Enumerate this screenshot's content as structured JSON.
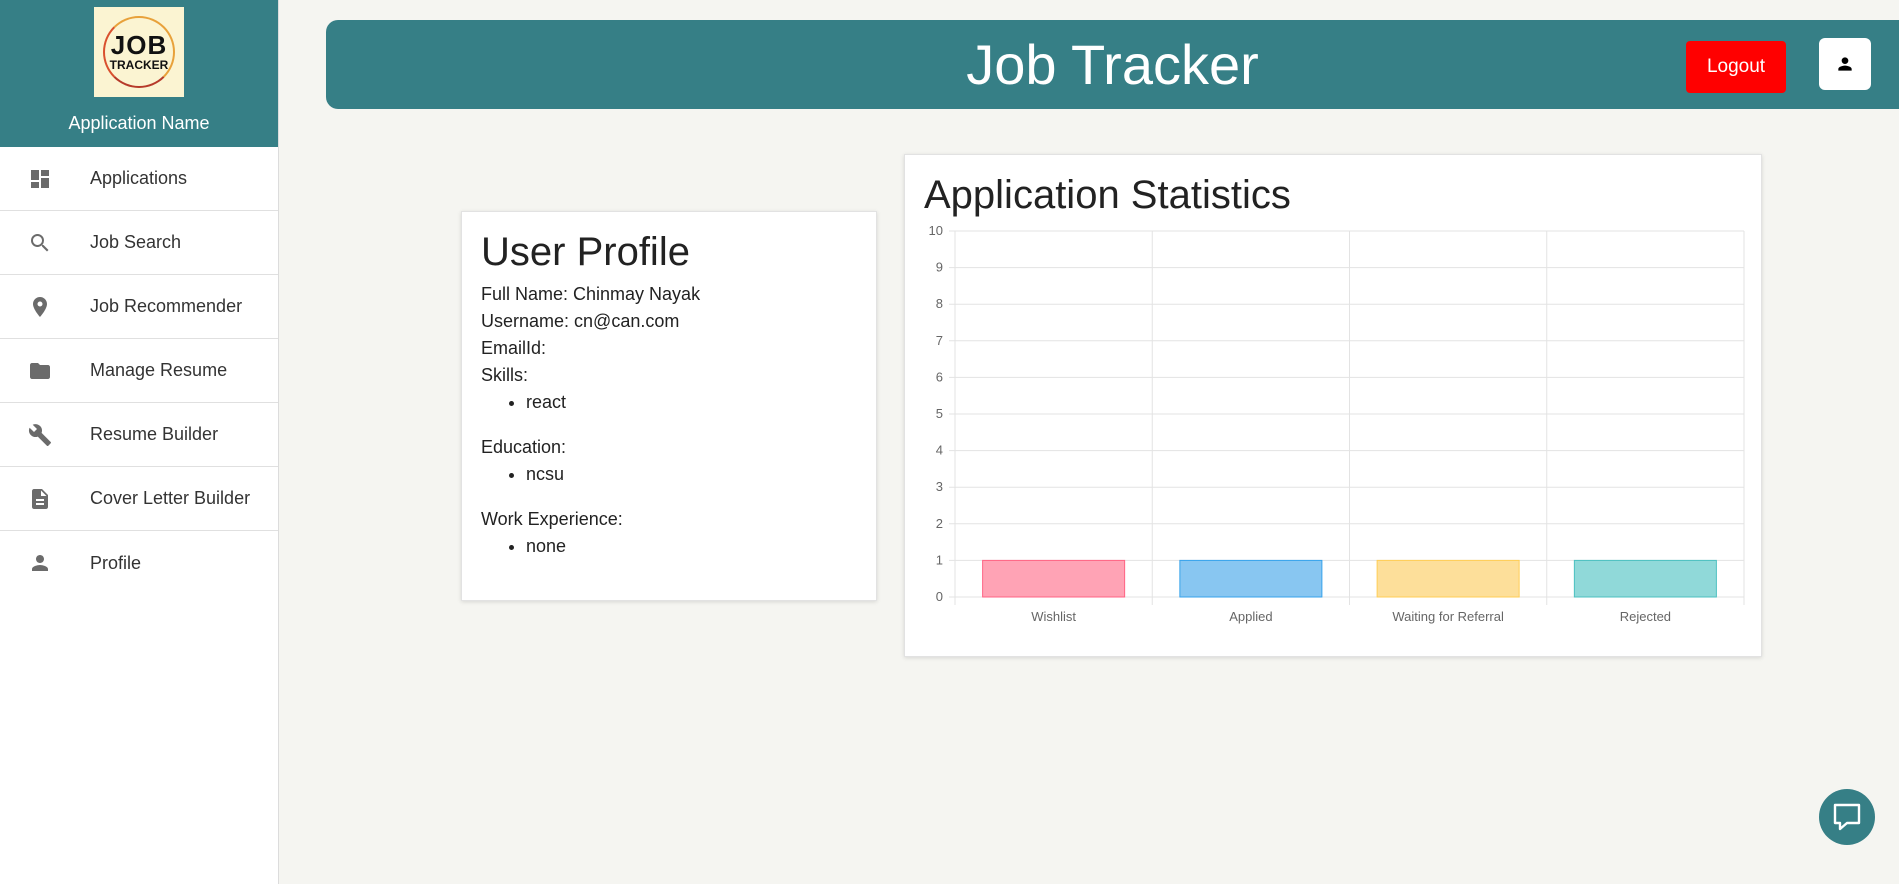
{
  "sidebar": {
    "logo": {
      "line1": "JOB",
      "line2": "TRACKER"
    },
    "app_name": "Application Name",
    "items": [
      {
        "label": "Applications",
        "icon": "dashboard-icon"
      },
      {
        "label": "Job Search",
        "icon": "search-icon"
      },
      {
        "label": "Job Recommender",
        "icon": "location-pin-icon"
      },
      {
        "label": "Manage Resume",
        "icon": "folder-icon"
      },
      {
        "label": "Resume Builder",
        "icon": "wrench-icon"
      },
      {
        "label": "Cover Letter Builder",
        "icon": "document-icon"
      },
      {
        "label": "Profile",
        "icon": "person-icon"
      }
    ]
  },
  "header": {
    "title": "Job Tracker",
    "logout_label": "Logout",
    "user_icon": "person-icon"
  },
  "profile": {
    "title": "User Profile",
    "full_name": "Full Name: Chinmay Nayak",
    "username": "Username: cn@can.com",
    "email": "EmailId:",
    "skills_label": "Skills:",
    "skills": [
      "react"
    ],
    "education_label": "Education:",
    "education": [
      "ncsu"
    ],
    "work_label": "Work Experience:",
    "work": [
      "none"
    ]
  },
  "stats": {
    "title": "Application Statistics"
  },
  "chart_data": {
    "type": "bar",
    "categories": [
      "Wishlist",
      "Applied",
      "Waiting for Referral",
      "Rejected"
    ],
    "values": [
      1,
      1,
      1,
      1
    ],
    "ylim": [
      0,
      10
    ],
    "yticks": [
      "0",
      "1",
      "2",
      "3",
      "4",
      "5",
      "6",
      "7",
      "8",
      "9",
      "10"
    ],
    "grid": true,
    "colors": [
      "#ffa3b5",
      "#88c6f1",
      "#fddf9a",
      "#90d9d9"
    ],
    "border_colors": [
      "#ff6384",
      "#36a2eb",
      "#ffcd56",
      "#4bc0c0"
    ]
  },
  "chat": {
    "icon": "chat-icon"
  },
  "colors": {
    "brand": "#367f86",
    "logout": "#ff0000"
  }
}
